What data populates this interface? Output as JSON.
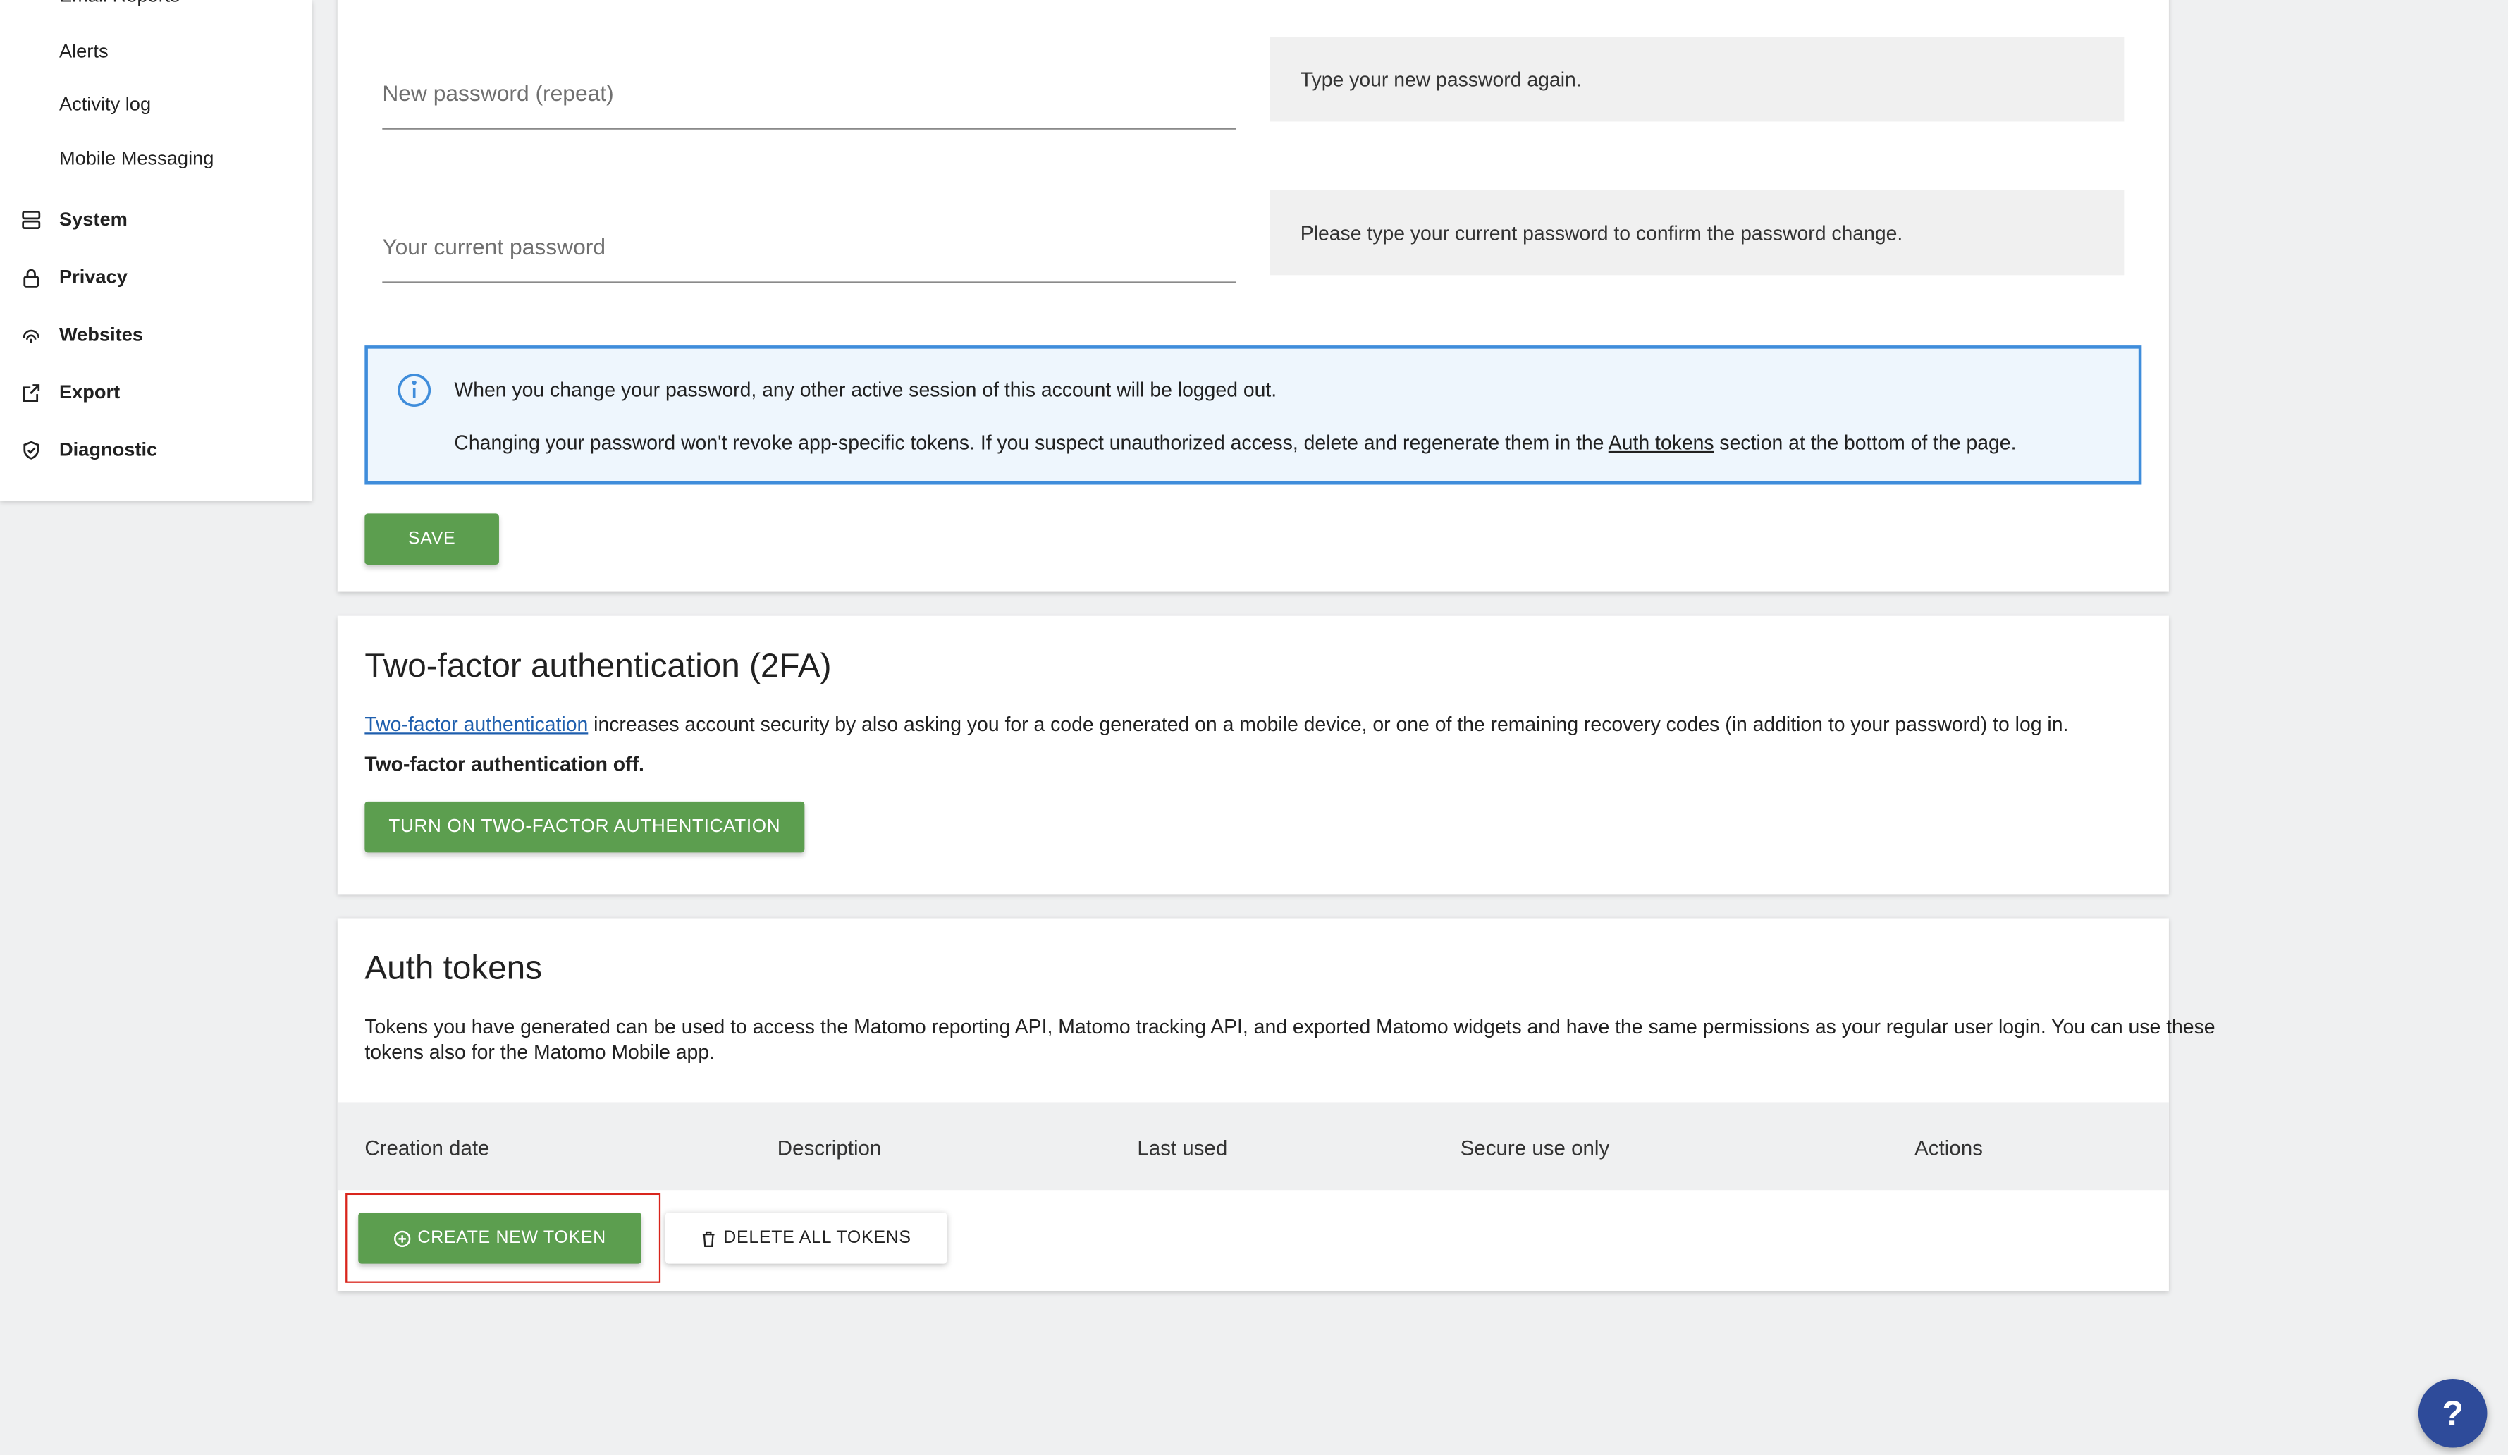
{
  "sidebar": {
    "sub_items": [
      "Email Reports",
      "Alerts",
      "Activity log",
      "Mobile Messaging"
    ],
    "sections": [
      {
        "label": "System",
        "icon": "server-icon"
      },
      {
        "label": "Privacy",
        "icon": "lock-icon"
      },
      {
        "label": "Websites",
        "icon": "fingerprint-icon"
      },
      {
        "label": "Export",
        "icon": "export-icon"
      },
      {
        "label": "Diagnostic",
        "icon": "shield-icon"
      }
    ]
  },
  "password_form": {
    "repeat_placeholder": "New password (repeat)",
    "repeat_help": "Type your new password again.",
    "current_placeholder": "Your current password",
    "current_help": "Please type your current password to confirm the password change.",
    "notice_line1": "When you change your password, any other active session of this account will be logged out.",
    "notice_line2_before": "Changing your password won't revoke app-specific tokens. If you suspect unauthorized access, delete and regenerate them in the ",
    "notice_line2_link": "Auth tokens",
    "notice_line2_after": " section at the bottom of the page.",
    "save_label": "SAVE"
  },
  "two_factor": {
    "title": "Two-factor authentication (2FA)",
    "desc_link": "Two-factor authentication",
    "desc_rest": " increases account security by also asking you for a code generated on a mobile device, or one of the remaining recovery codes (in addition to your password) to log in.",
    "status": "Two-factor authentication off.",
    "button_label": "TURN ON TWO-FACTOR AUTHENTICATION"
  },
  "auth_tokens": {
    "title": "Auth tokens",
    "description_line1": "Tokens you have generated can be used to access the Matomo reporting API, Matomo tracking API, and exported Matomo widgets and have the same permissions as your regular user login. You can use these",
    "description_line2": "tokens also for the Matomo Mobile app.",
    "columns": [
      "Creation date",
      "Description",
      "Last used",
      "Secure use only",
      "Actions"
    ],
    "create_label": "CREATE NEW TOKEN",
    "delete_all_label": "DELETE ALL TOKENS"
  },
  "help_fab": "?",
  "colors": {
    "primary_green": "#5c9e4f",
    "notice_border": "#3f8ddb",
    "highlight_red": "#d9251c",
    "fab_blue": "#2e4b9a"
  }
}
